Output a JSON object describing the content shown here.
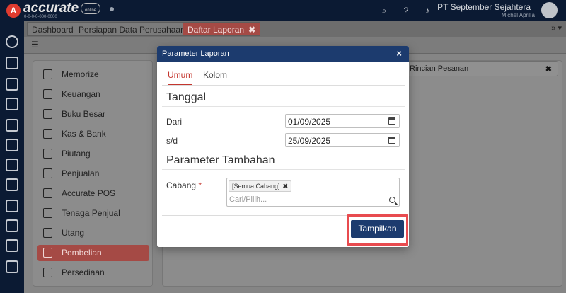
{
  "app": {
    "logo_letter": "A",
    "logo_text": "accurate",
    "logo_sub": "0-0-0-0-000-0000",
    "logo_online": "online",
    "company_name": "PT September Sejahtera",
    "user_name": "Michel Aprilia"
  },
  "tabs": [
    {
      "label": "Dashboard"
    },
    {
      "label": "Persiapan Data Perusahaan"
    },
    {
      "label": "Daftar Laporan",
      "close": "✖"
    }
  ],
  "tab_more": "» ▾",
  "sidebar_menu": [
    {
      "label": "Memorize"
    },
    {
      "label": "Keuangan"
    },
    {
      "label": "Buku Besar"
    },
    {
      "label": "Kas & Bank"
    },
    {
      "label": "Piutang"
    },
    {
      "label": "Penjualan"
    },
    {
      "label": "Accurate POS"
    },
    {
      "label": "Tenaga Penjual"
    },
    {
      "label": "Utang"
    },
    {
      "label": "Pembelian"
    },
    {
      "label": "Persediaan"
    }
  ],
  "report_chip": {
    "label": "Rincian Pesanan",
    "close": "✖"
  },
  "modal": {
    "title": "Parameter Laporan",
    "close": "×",
    "tabs": [
      {
        "label": "Umum"
      },
      {
        "label": "Kolom"
      }
    ],
    "section_date": "Tanggal",
    "from_label": "Dari",
    "from_value": "01/09/2025",
    "to_label": "s/d",
    "to_value": "25/09/2025",
    "section_extra": "Parameter Tambahan",
    "cabang_label": "Cabang",
    "cabang_required": "*",
    "cabang_tag": "[Semua Cabang]",
    "cabang_tag_remove": "✖",
    "cabang_placeholder": "Cari/Pilih...",
    "submit_label": "Tampilkan"
  },
  "colors": {
    "brand_navy": "#1c3b6e",
    "accent_red": "#c4362e",
    "highlight": "#e84b4f"
  }
}
